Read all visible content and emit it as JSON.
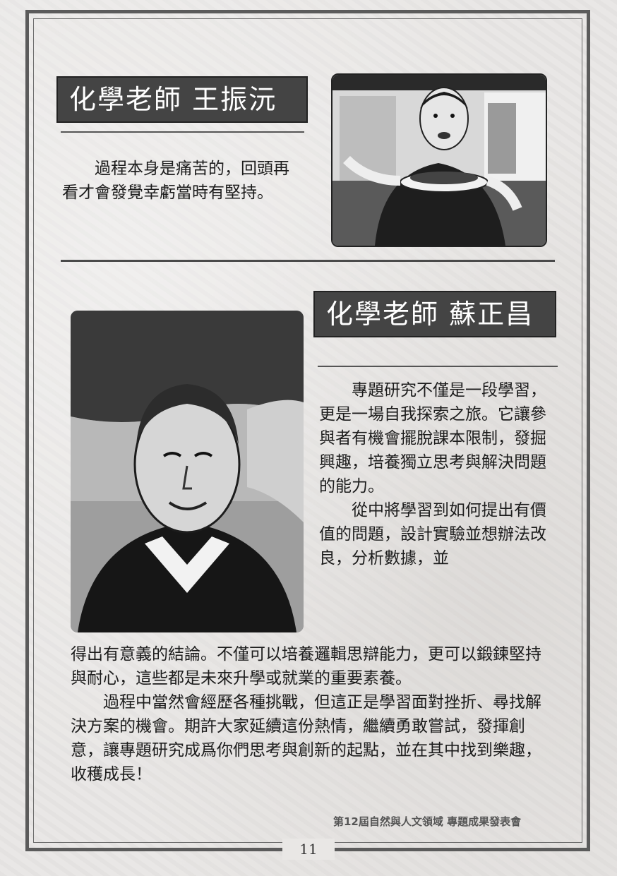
{
  "teacher1": {
    "title": "化學老師  王振沅",
    "quote": "過程本身是痛苦的，回頭再看才會發覺幸虧當時有堅持。"
  },
  "teacher2": {
    "title": "化學老師  蘇正昌",
    "para1": "專題研究不僅是一段學習，更是一場自我探索之旅。它讓參與者有機會擺脫課本限制，發掘興趣，培養獨立思考與解決問題的能力。",
    "para2": "從中將學習到如何提出有價值的問題，設計實驗並想辦法改良，分析數據，並",
    "para2_cont": "得出有意義的結論。不僅可以培養邏輯思辯能力，更可以鍛鍊堅持與耐心，這些都是未來升學或就業的重要素養。",
    "para3": "過程中當然會經歷各種挑戰，但這正是學習面對挫折、尋找解決方案的機會。期許大家延續這份熱情，繼續勇敢嘗試，發揮創意，讓專題研究成爲你們思考與創新的起點，並在其中找到樂趣，收穫成長！"
  },
  "footer": {
    "caption": "第12屆自然與人文領域  專題成果發表會",
    "page_number": "11"
  }
}
